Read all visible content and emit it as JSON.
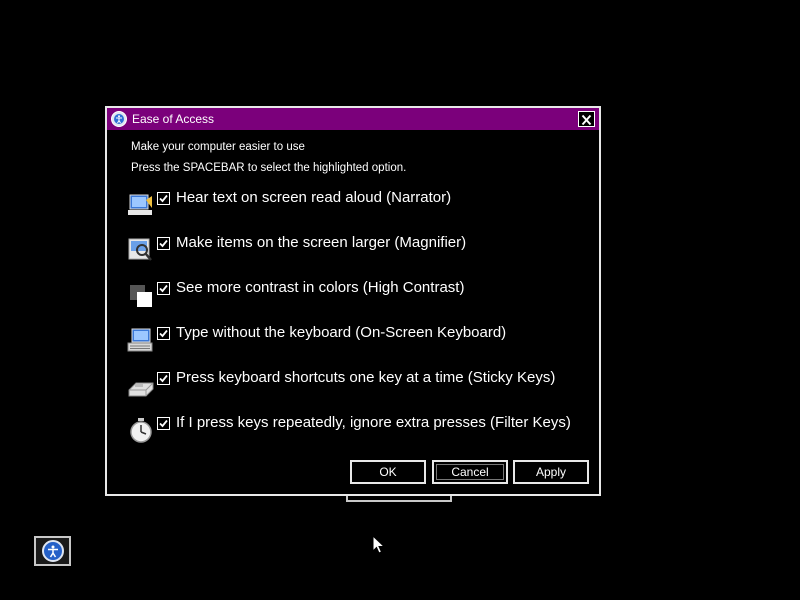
{
  "dialog": {
    "title": "Ease of Access",
    "intro_line1": "Make your computer easier to use",
    "intro_line2": "Press the SPACEBAR to select the highlighted option.",
    "options": [
      {
        "label": "Hear text on screen read aloud (Narrator)",
        "checked": true,
        "icon": "narrator-icon"
      },
      {
        "label": "Make items on the screen larger (Magnifier)",
        "checked": true,
        "icon": "magnifier-icon"
      },
      {
        "label": "See more contrast in colors (High Contrast)",
        "checked": true,
        "icon": "high-contrast-icon"
      },
      {
        "label": "Type without the keyboard (On-Screen Keyboard)",
        "checked": true,
        "icon": "on-screen-keyboard-icon"
      },
      {
        "label": "Press keyboard shortcuts one key at a time (Sticky Keys)",
        "checked": true,
        "icon": "sticky-keys-icon"
      },
      {
        "label": "If I press keys repeatedly, ignore extra presses (Filter Keys)",
        "checked": true,
        "icon": "filter-keys-icon"
      }
    ],
    "buttons": {
      "ok": "OK",
      "cancel": "Cancel",
      "apply": "Apply"
    }
  },
  "colors": {
    "titlebar": "#7b007b",
    "background": "#000000",
    "text": "#ffffff"
  }
}
